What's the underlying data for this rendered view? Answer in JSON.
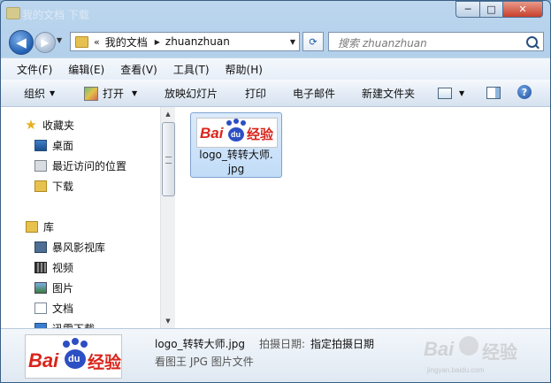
{
  "window": {
    "title": "我的文档 下载",
    "controls": {
      "minimize": "─",
      "maximize": "□",
      "close": "✕"
    }
  },
  "nav": {
    "back_glyph": "◀",
    "forward_glyph": "▶",
    "dropdown_glyph": "▼",
    "address": {
      "chevron": "«",
      "segments": [
        "我的文档",
        "zhuanzhuan"
      ],
      "separator": "▶",
      "dropdown_glyph": "▼"
    },
    "refresh_glyph": "⟳",
    "search_placeholder": "搜索 zhuanzhuan"
  },
  "menubar": {
    "items": [
      "文件(F)",
      "编辑(E)",
      "查看(V)",
      "工具(T)",
      "帮助(H)"
    ]
  },
  "toolbar": {
    "organize": "组织",
    "open": "打开",
    "slideshow": "放映幻灯片",
    "print": "打印",
    "email": "电子邮件",
    "new_folder": "新建文件夹",
    "caret": "▼",
    "help": "?"
  },
  "navpane": {
    "favorites": {
      "label": "收藏夹",
      "items": [
        "桌面",
        "最近访问的位置",
        "下载"
      ]
    },
    "libraries": {
      "label": "库",
      "items": [
        "暴风影视库",
        "视频",
        "图片",
        "文档",
        "迅雷下载"
      ]
    }
  },
  "files": [
    {
      "name_line1": "logo_转转大师.",
      "name_line2": "jpg"
    }
  ],
  "logo": {
    "bai": "Bai",
    "du": "du",
    "jingyan": "经验"
  },
  "details": {
    "file_name": "logo_转转大师.jpg",
    "date_label": "拍摄日期:",
    "date_value": "指定拍摄日期",
    "file_type": "看图王 JPG 图片文件"
  },
  "watermark": {
    "text": "经验",
    "sub": "jingyan.baidu.com"
  },
  "colors": {
    "selection": "#c1dcf8",
    "baidu_red": "#d9251c",
    "baidu_blue": "#2d4fc4"
  }
}
